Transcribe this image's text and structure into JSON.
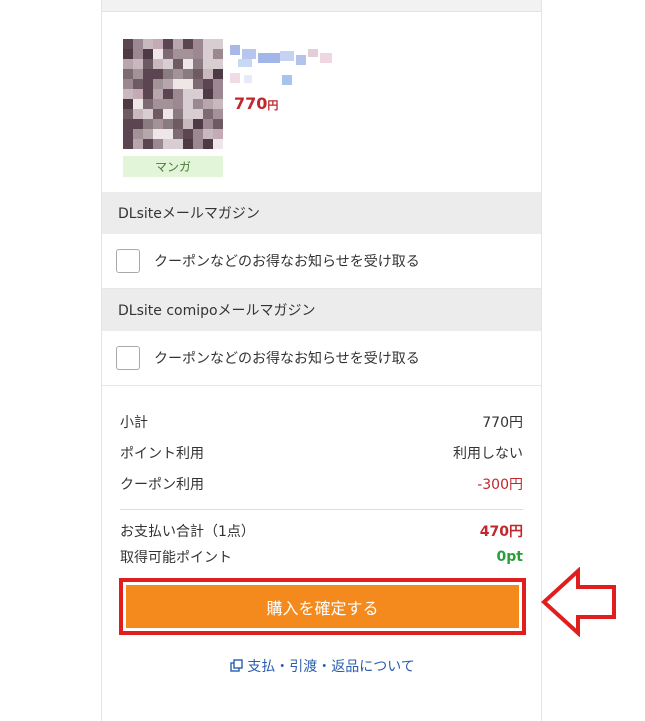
{
  "product": {
    "price": "770",
    "price_unit": "円",
    "genre": "マンガ"
  },
  "newsletters": [
    {
      "title": "DLsiteメールマガジン",
      "checkbox_label": "クーポンなどのお得なお知らせを受け取る"
    },
    {
      "title": "DLsite comipoメールマガジン",
      "checkbox_label": "クーポンなどのお得なお知らせを受け取る"
    }
  ],
  "summary": {
    "subtotal_label": "小計",
    "subtotal_value": "770円",
    "points_label": "ポイント利用",
    "points_value": "利用しない",
    "coupon_label": "クーポン利用",
    "coupon_value": "-300円",
    "total_label": "お支払い合計（1点）",
    "total_value": "470円",
    "earn_label": "取得可能ポイント",
    "earn_value": "0pt"
  },
  "buy_button_label": "購入を確定する",
  "help_link_label": "支払・引渡・返品について",
  "colors": {
    "accent_orange": "#f48a1e",
    "highlight_red": "#e01e1e",
    "price_red": "#c1272d",
    "point_green": "#2a9e3a",
    "link_blue": "#2a5db0"
  }
}
